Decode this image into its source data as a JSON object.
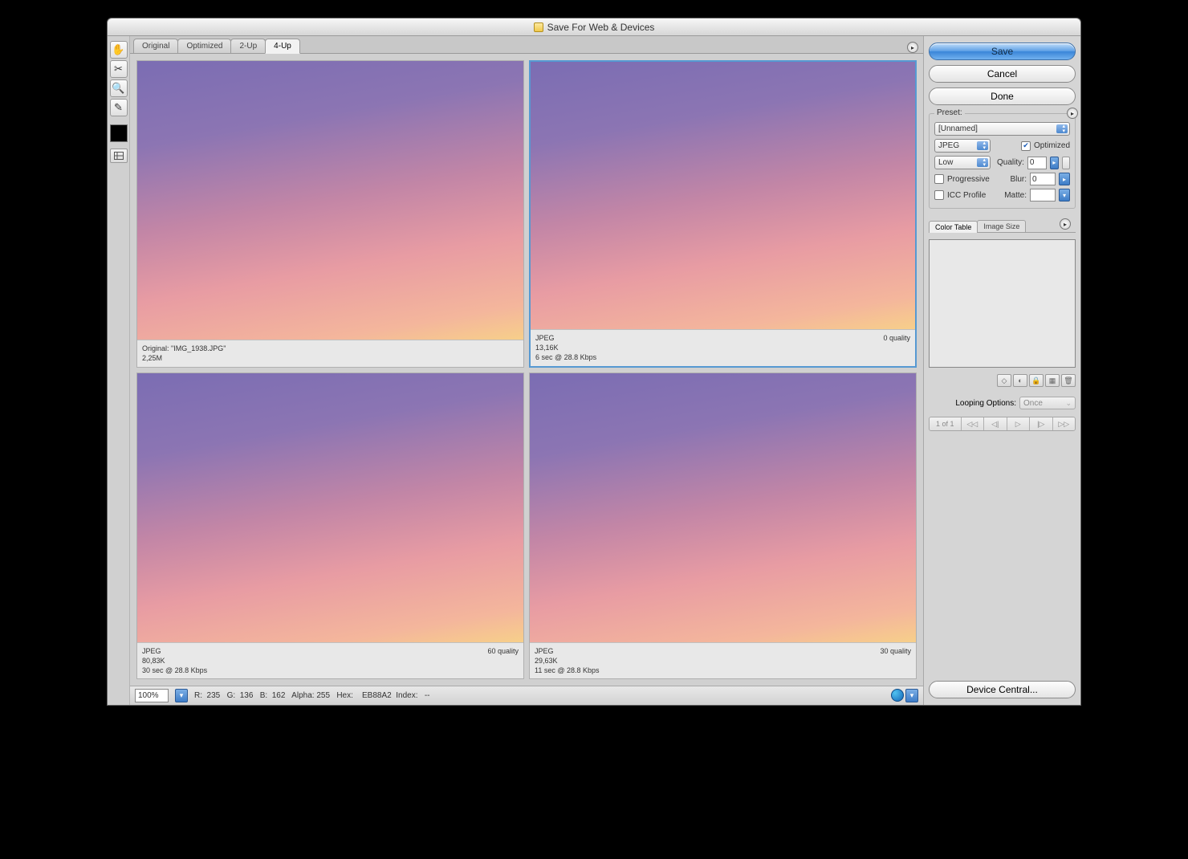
{
  "title": "Save For Web & Devices",
  "tabs": {
    "original": "Original",
    "optimized": "Optimized",
    "two_up": "2-Up",
    "four_up": "4-Up"
  },
  "previews": [
    {
      "line1": "Original: \"IMG_1938.JPG\"",
      "line2": "2,25M",
      "line3": "",
      "right": ""
    },
    {
      "line1": "JPEG",
      "line2": "13,16K",
      "line3": "6 sec @ 28.8 Kbps",
      "right": "0 quality"
    },
    {
      "line1": "JPEG",
      "line2": "80,83K",
      "line3": "30 sec @ 28.8 Kbps",
      "right": "60 quality"
    },
    {
      "line1": "JPEG",
      "line2": "29,63K",
      "line3": "11 sec @ 28.8 Kbps",
      "right": "30 quality"
    }
  ],
  "status": {
    "zoom": "100%",
    "info": "R:  235   G:  136   B:  162   Alpha: 255   Hex:    EB88A2  Index:   --"
  },
  "buttons": {
    "save": "Save",
    "cancel": "Cancel",
    "done": "Done",
    "device_central": "Device Central..."
  },
  "preset": {
    "label": "Preset:",
    "value": "[Unnamed]",
    "format": "JPEG",
    "optimized_label": "Optimized",
    "optimized_checked": true,
    "quality_preset": "Low",
    "quality_label": "Quality:",
    "quality_value": "0",
    "progressive_label": "Progressive",
    "progressive_checked": false,
    "blur_label": "Blur:",
    "blur_value": "0",
    "icc_label": "ICC Profile",
    "icc_checked": false,
    "matte_label": "Matte:"
  },
  "subtabs": {
    "color_table": "Color Table",
    "image_size": "Image Size"
  },
  "looping": {
    "label": "Looping Options:",
    "value": "Once"
  },
  "anim": {
    "count": "1 of 1"
  }
}
